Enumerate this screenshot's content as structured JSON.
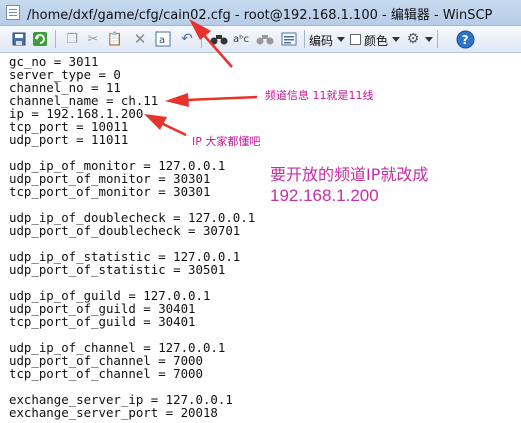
{
  "window": {
    "title": "/home/dxf/game/cfg/cain02.cfg - root@192.168.1.100 - 编辑器 - WinSCP"
  },
  "toolbar": {
    "encoding_label": "编码",
    "color_label": "颜色",
    "help_label": "?"
  },
  "editor": {
    "lines": [
      "gc_no = 3011",
      "server_type = 0",
      "channel_no = 11",
      "channel_name = ch.11",
      "ip = 192.168.1.200",
      "tcp_port = 10011",
      "udp_port = 11011",
      "",
      "udp_ip_of_monitor = 127.0.0.1",
      "udp_port_of_monitor = 30301",
      "tcp_port_of_monitor = 30301",
      "",
      "udp_ip_of_doublecheck = 127.0.0.1",
      "udp_port_of_doublecheck = 30701",
      "",
      "udp_ip_of_statistic = 127.0.0.1",
      "udp_port_of_statistic = 30501",
      "",
      "udp_ip_of_guild = 127.0.0.1",
      "udp_port_of_guild = 30401",
      "tcp_port_of_guild = 30401",
      "",
      "udp_ip_of_channel = 127.0.0.1",
      "udp_port_of_channel = 7000",
      "tcp_port_of_channel = 7000",
      "",
      "exchange_server_ip = 127.0.0.1",
      "exchange_server_port = 20018"
    ]
  },
  "annotations": {
    "channel_note": "频道信息 11就是11线",
    "ip_note": "IP 大家都懂吧",
    "change_note": "要开放的频道IP就改成",
    "change_ip": "192.168.1.200",
    "arrow_color": "#e8322c",
    "text_color": "#c8179b"
  }
}
